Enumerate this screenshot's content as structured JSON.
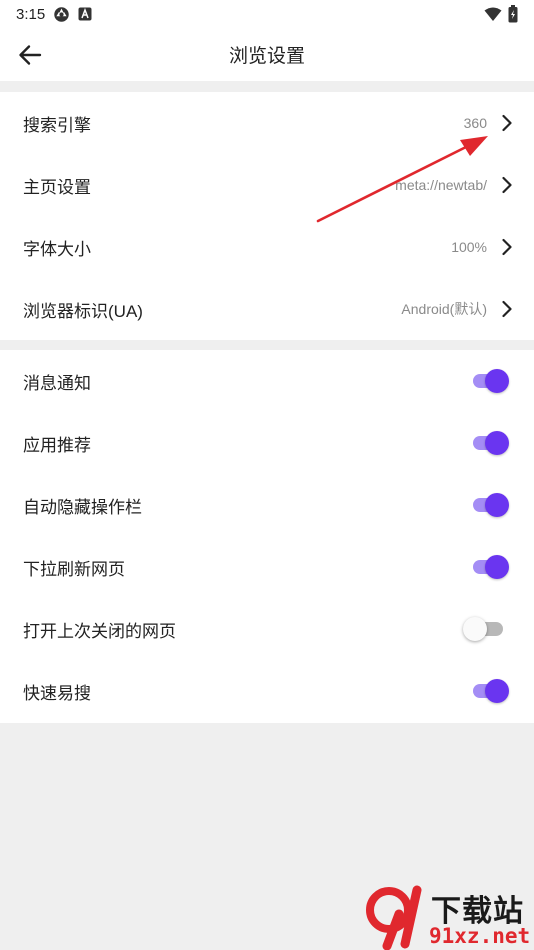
{
  "status_bar": {
    "time": "3:15"
  },
  "header": {
    "title": "浏览设置"
  },
  "settings_group_1": [
    {
      "label": "搜索引擎",
      "value": "360"
    },
    {
      "label": "主页设置",
      "value": "meta://newtab/"
    },
    {
      "label": "字体大小",
      "value": "100%"
    },
    {
      "label": "浏览器标识(UA)",
      "value": "Android(默认)"
    }
  ],
  "settings_group_2": [
    {
      "label": "消息通知",
      "enabled": true
    },
    {
      "label": "应用推荐",
      "enabled": true
    },
    {
      "label": "自动隐藏操作栏",
      "enabled": true
    },
    {
      "label": "下拉刷新网页",
      "enabled": true
    },
    {
      "label": "打开上次关闭的网页",
      "enabled": false
    },
    {
      "label": "快速易搜",
      "enabled": true
    }
  ],
  "colors": {
    "accent": "#6a35f0",
    "accent_track": "#a48df5",
    "annotation_arrow": "#e0282e",
    "background": "#efefef"
  },
  "watermark": {
    "title": "下载站",
    "site": "91xz.net"
  }
}
